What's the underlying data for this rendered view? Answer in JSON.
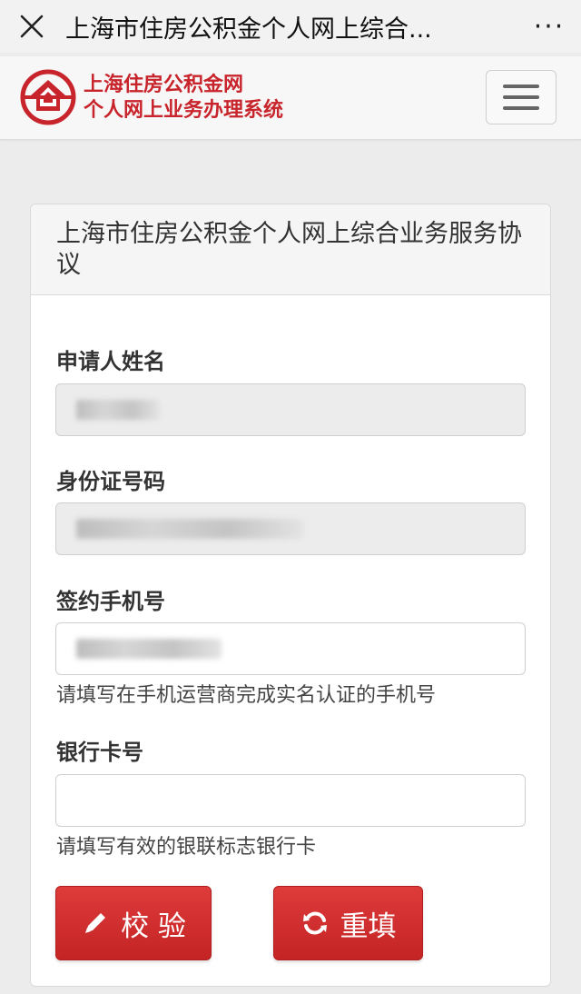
{
  "topbar": {
    "title": "上海市住房公积金个人网上综合...",
    "close_icon": "close-icon",
    "more_icon": "more-icon",
    "more_glyph": "···"
  },
  "header": {
    "brand_line1": "上海住房公积金网",
    "brand_line2": "个人网上业务办理系统",
    "logo_icon": "house-logo-icon",
    "menu_icon": "hamburger-menu-icon",
    "brand_color": "#c8242b"
  },
  "panel": {
    "title": "上海市住房公积金个人网上综合业务服务协议"
  },
  "form": {
    "name_label": "申请人姓名",
    "id_label": "身份证号码",
    "phone_label": "签约手机号",
    "phone_hint": "请填写在手机运营商完成实名认证的手机号",
    "card_label": "银行卡号",
    "card_hint": "请填写有效的银联标志银行卡"
  },
  "buttons": {
    "verify_label": "校 验",
    "verify_icon": "pencil-icon",
    "reset_label": "重填",
    "reset_icon": "refresh-icon",
    "accent_color": "#cf2e2e"
  }
}
